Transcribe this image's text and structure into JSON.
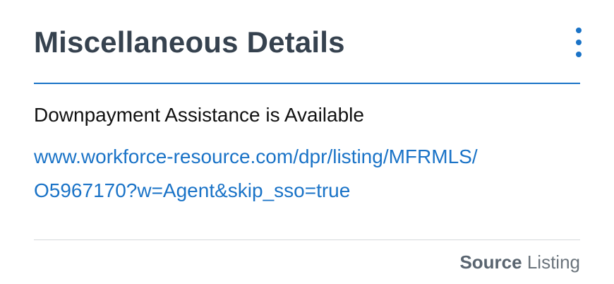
{
  "card": {
    "title": "Miscellaneous Details",
    "menu_icon": "kebab-menu-icon",
    "accent_color": "#1a73c7",
    "title_color": "#36424f"
  },
  "details": {
    "feature": "Downpayment Assistance is Available",
    "link_line1": "www.workforce-resource.com/dpr/listing/MFRMLS/",
    "link_line2": "O5967170?w=Agent&skip_sso=true"
  },
  "footer": {
    "source_label": "Source",
    "source_value": "Listing"
  }
}
